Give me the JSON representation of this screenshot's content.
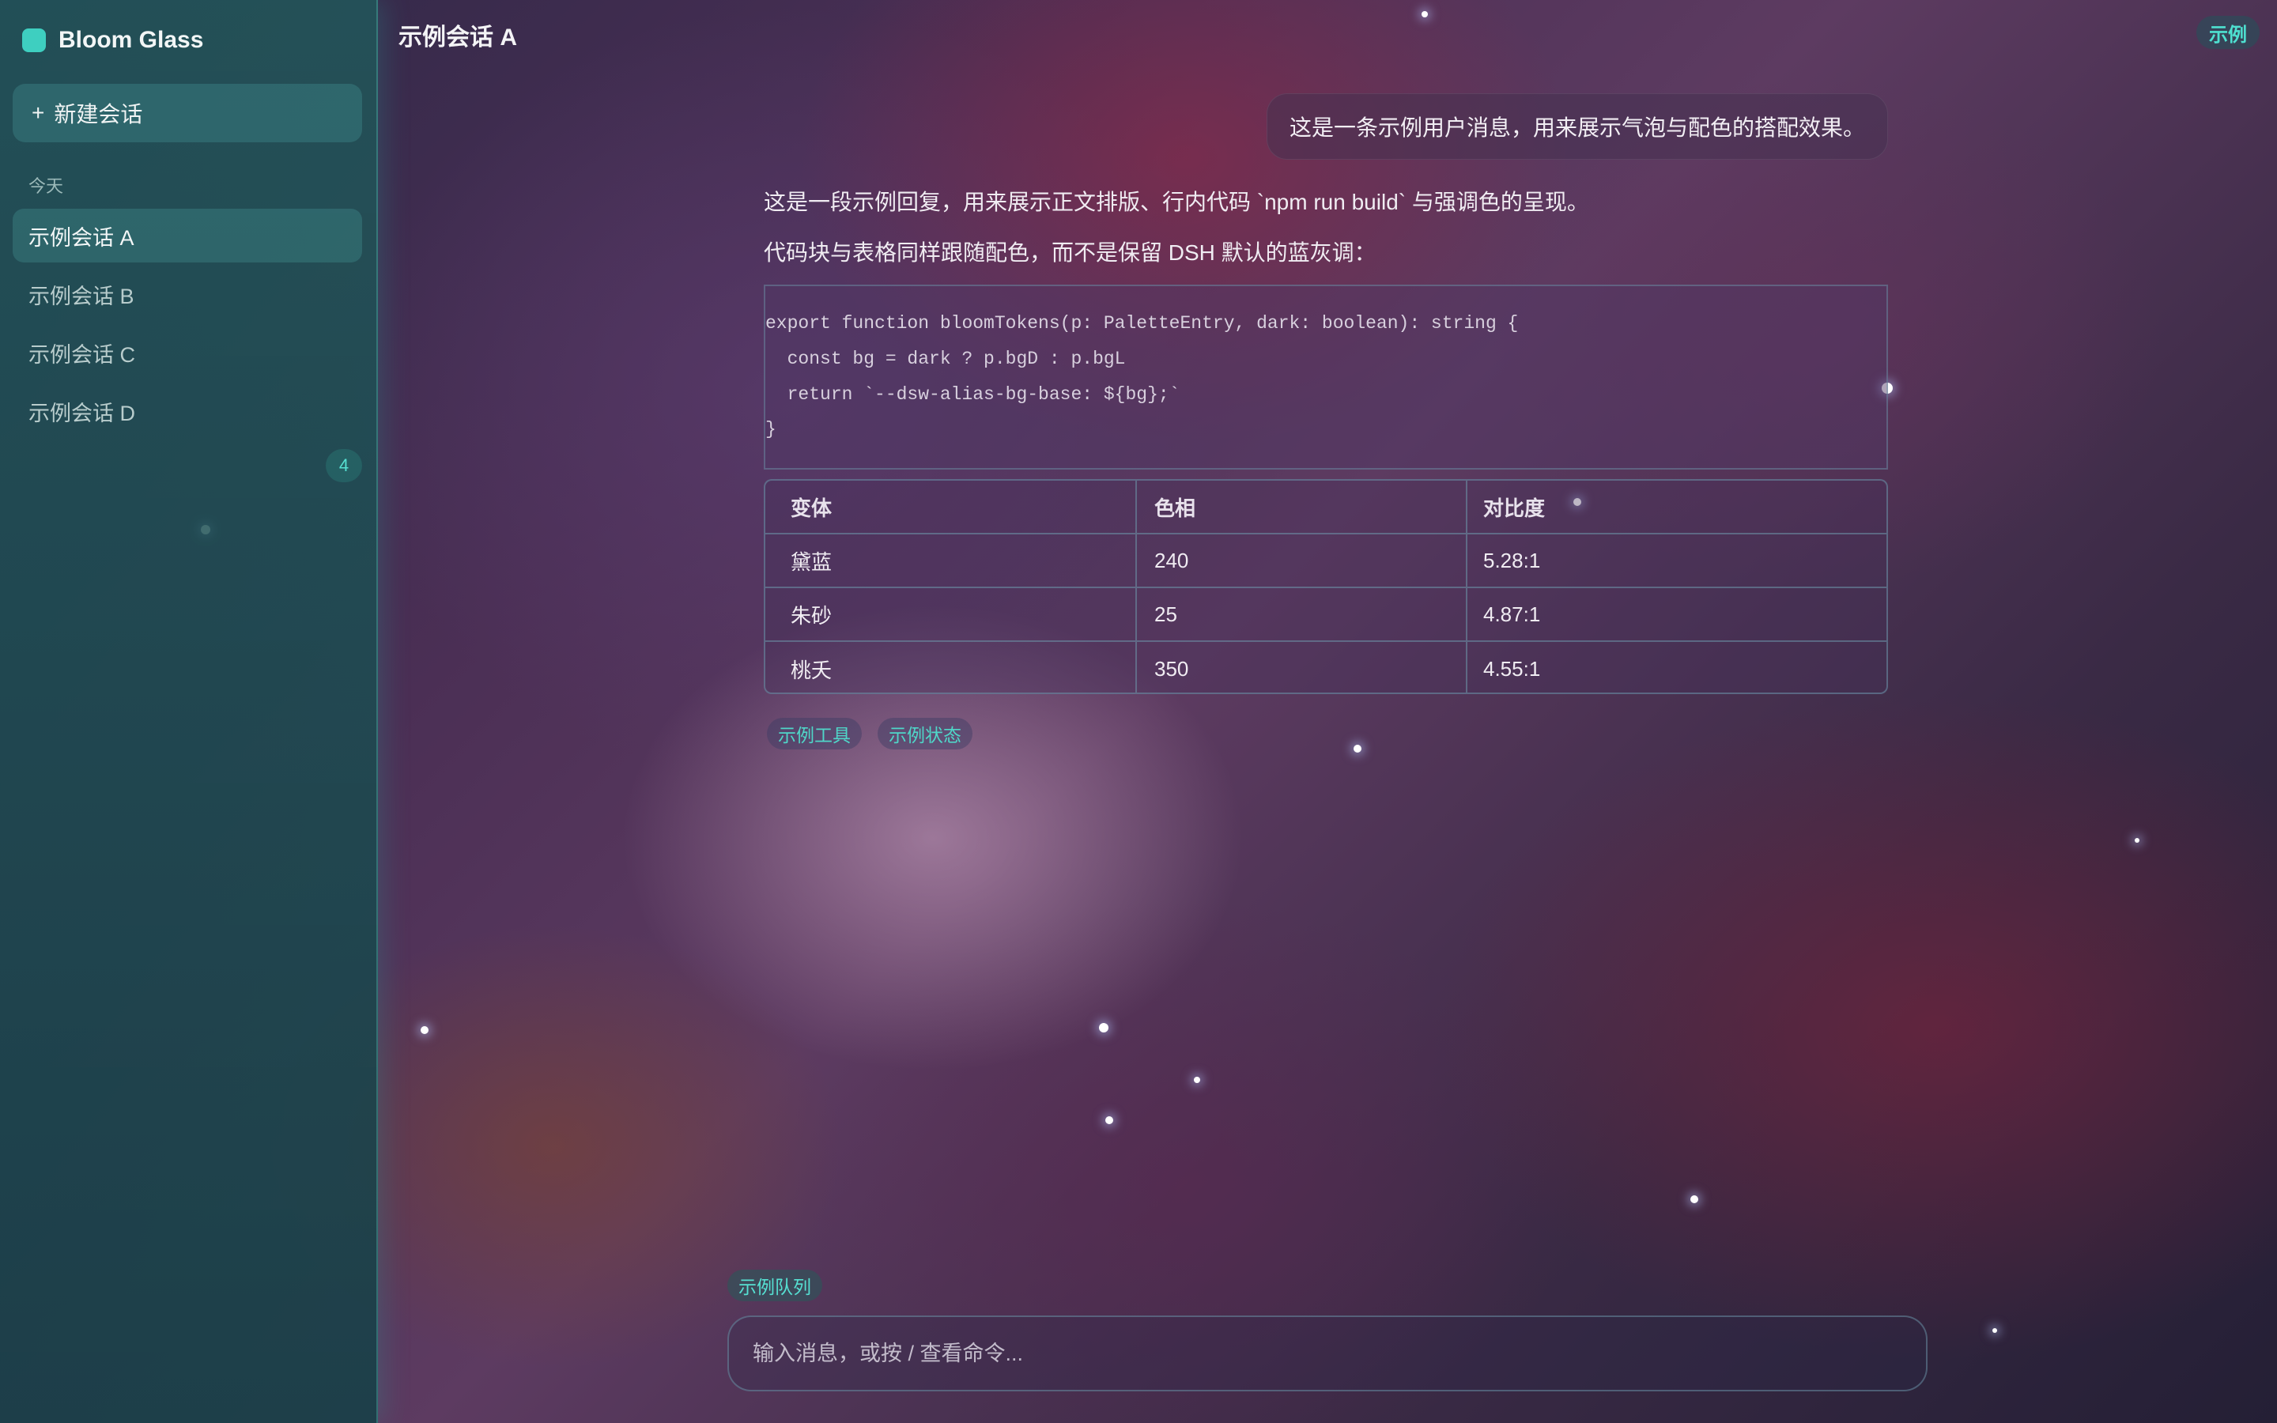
{
  "app": {
    "name": "Bloom Glass",
    "accent_color": "#3ecfc0"
  },
  "sidebar": {
    "new_chat_icon": "+",
    "new_chat_label": "新建会话",
    "section_label": "今天",
    "items": [
      {
        "label": "示例会话 A",
        "active": true
      },
      {
        "label": "示例会话 B",
        "active": false
      },
      {
        "label": "示例会话 C",
        "active": false
      },
      {
        "label": "示例会话 D",
        "active": false
      }
    ],
    "count_badge": "4"
  },
  "header": {
    "title": "示例会话 A",
    "badge": "示例"
  },
  "messages": {
    "user": "这是一条示例用户消息，用来展示气泡与配色的搭配效果。",
    "assistant": {
      "line1": "这是一段示例回复，用来展示正文排版、行内代码 `npm run build` 与强调色的呈现。",
      "line2": "代码块与表格同样跟随配色，而不是保留 DSH 默认的蓝灰调：",
      "code_lines": [
        "export function bloomTokens(p: PaletteEntry, dark: boolean): string {",
        "  const bg = dark ? p.bgD : p.bgL",
        "  return `--dsw-alias-bg-base: ${bg};`",
        "}"
      ],
      "table": {
        "headers": [
          "变体",
          "色相",
          "对比度"
        ],
        "rows": [
          [
            "黛蓝",
            "240",
            "5.28:1"
          ],
          [
            "朱砂",
            "25",
            "4.87:1"
          ],
          [
            "桃夭",
            "350",
            "4.55:1"
          ]
        ]
      },
      "chips": [
        "示例工具",
        "示例状态"
      ]
    }
  },
  "composer": {
    "queue_chip": "示例队列",
    "placeholder": "输入消息，或按 / 查看命令..."
  }
}
